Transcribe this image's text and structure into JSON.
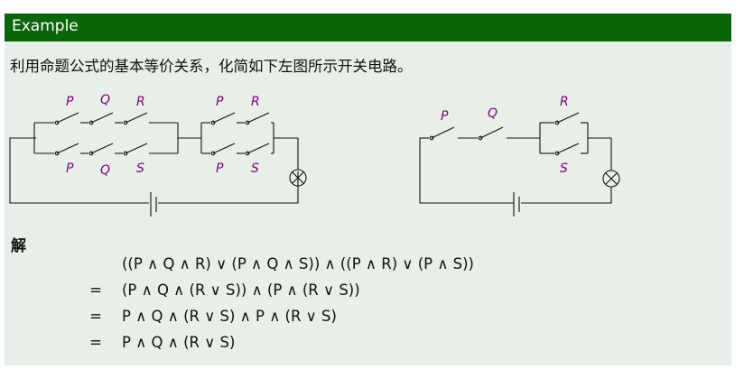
{
  "block": {
    "title": "Example",
    "intro": "利用命题公式的基本等价关系，化简如下左图所示开关电路。",
    "solution_label": "解"
  },
  "circuit_left": {
    "top_labels_1": [
      "P",
      "Q",
      "R"
    ],
    "bottom_labels_1": [
      "P",
      "Q",
      "S"
    ],
    "top_labels_2": [
      "P",
      "R"
    ],
    "bottom_labels_2": [
      "P",
      "S"
    ]
  },
  "circuit_right": {
    "series_labels": [
      "P",
      "Q"
    ],
    "parallel_top": "R",
    "parallel_bottom": "S"
  },
  "equations": [
    {
      "symbol": "",
      "expr": "((P ∧ Q ∧ R) ∨ (P ∧ Q ∧ S)) ∧ ((P ∧ R) ∨ (P ∧ S))"
    },
    {
      "symbol": "=",
      "expr": "(P ∧ Q ∧ (R ∨ S)) ∧ (P ∧ (R ∨ S))"
    },
    {
      "symbol": "=",
      "expr": "P ∧ Q ∧ (R ∨ S) ∧ P ∧ (R ∨ S)"
    },
    {
      "symbol": "=",
      "expr": "P ∧ Q ∧ (R ∨ S)"
    }
  ],
  "colors": {
    "header": "#0b650b",
    "block_bg": "#e8efe8",
    "label": "#800080"
  }
}
